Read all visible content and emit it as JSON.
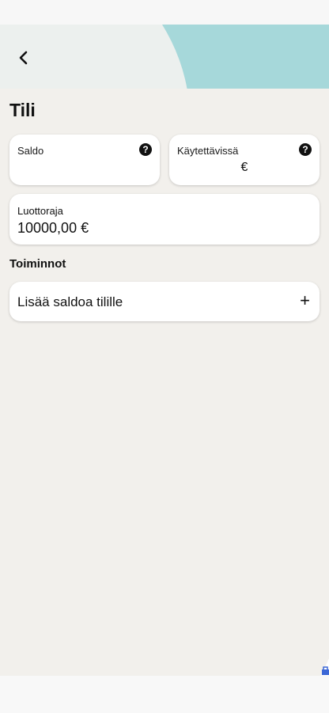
{
  "header": {
    "back_icon": "chevron-left-icon",
    "accent_color": "#a6d8da"
  },
  "page": {
    "title": "Tili"
  },
  "balance_card": {
    "label": "Saldo",
    "help_glyph": "?"
  },
  "available_card": {
    "label": "Käytettävissä",
    "value": "€",
    "help_glyph": "?"
  },
  "credit_card": {
    "label": "Luottoraja",
    "value": "10000,00 €"
  },
  "actions": {
    "heading": "Toiminnot",
    "items": [
      {
        "label": "Lisää saldoa tilille",
        "icon": "+"
      }
    ]
  }
}
